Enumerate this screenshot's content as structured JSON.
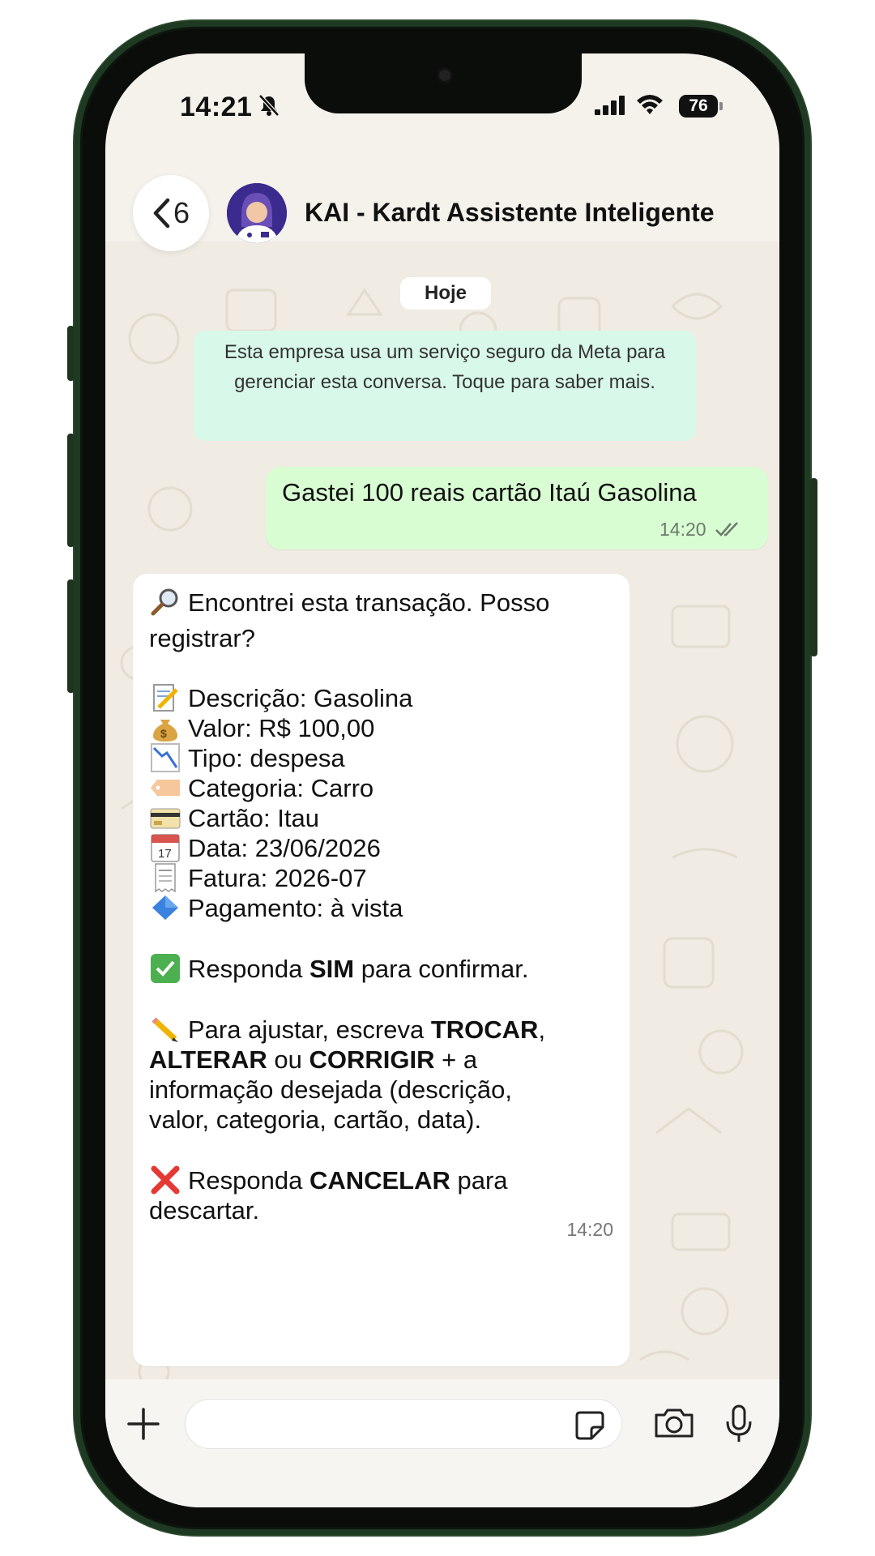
{
  "status_bar": {
    "time": "14:21",
    "battery": "76"
  },
  "header": {
    "back_count": "6",
    "contact_name": "KAI - Kardt Assistente Inteligente"
  },
  "chat": {
    "day_label": "Hoje",
    "system_notice": "Esta empresa usa um serviço seguro da Meta para gerenciar esta conversa. Toque para saber mais.",
    "outgoing": {
      "text": "Gastei 100 reais cartão Itaú Gasolina",
      "time": "14:20"
    },
    "incoming": {
      "intro_line1": "Encontrei esta transação. Posso",
      "intro_line2": "registrar?",
      "fields": [
        {
          "icon": "memo-icon",
          "text": "Descrição: Gasolina"
        },
        {
          "icon": "money-bag-icon",
          "text": "Valor: R$ 100,00"
        },
        {
          "icon": "chart-decreasing-icon",
          "text": "Tipo: despesa"
        },
        {
          "icon": "label-tag-icon",
          "text": "Categoria: Carro"
        },
        {
          "icon": "credit-card-icon",
          "text": "Cartão: Itau"
        },
        {
          "icon": "calendar-icon",
          "text": "Data: 23/06/2026"
        },
        {
          "icon": "receipt-icon",
          "text": "Fatura: 2026-07"
        },
        {
          "icon": "blue-diamond-icon",
          "text": "Pagamento: à vista"
        }
      ],
      "confirm": {
        "prefix": "Responda ",
        "keyword": "SIM",
        "suffix": " para confirmar."
      },
      "adjust": {
        "prefix": "Para ajustar, escreva ",
        "kw1": "TROCAR",
        "comma": ",",
        "kw2": "ALTERAR",
        "mid": " ou ",
        "kw3": "CORRIGIR",
        "tail": " + a",
        "line3": "informação desejada (descrição,",
        "line4": "valor, categoria, cartão, data)."
      },
      "cancel": {
        "prefix": "Responda ",
        "keyword": "CANCELAR",
        "suffix": " para",
        "line2": "descartar."
      },
      "time": "14:20"
    }
  },
  "colors": {
    "outgoing_bubble": "#d9fdd3",
    "system_notice": "#d8f8ea",
    "wallpaper": "#f0ebe3"
  }
}
